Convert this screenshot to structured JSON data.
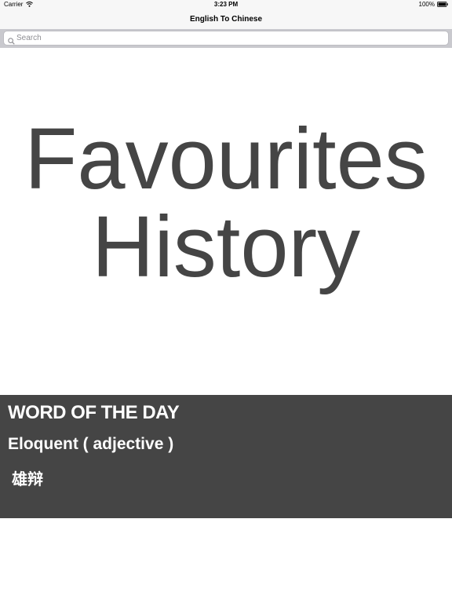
{
  "status_bar": {
    "carrier": "Carrier",
    "time": "3:23 PM",
    "battery": "100%",
    "icons": [
      "wifi-icon",
      "battery-icon"
    ]
  },
  "nav": {
    "title": "English To Chinese"
  },
  "search": {
    "placeholder": "Search",
    "value": "",
    "icon": "search-icon"
  },
  "main": {
    "favourites_label": "Favourites",
    "history_label": "History"
  },
  "word_of_the_day": {
    "heading": "WORD OF THE DAY",
    "word": "Eloquent ( adjective )",
    "translation": "雄辩"
  },
  "colors": {
    "text_dark": "#454545",
    "panel_bg": "#454545",
    "bar_bg": "#f7f7f7",
    "search_bg": "#c9c9ce"
  }
}
